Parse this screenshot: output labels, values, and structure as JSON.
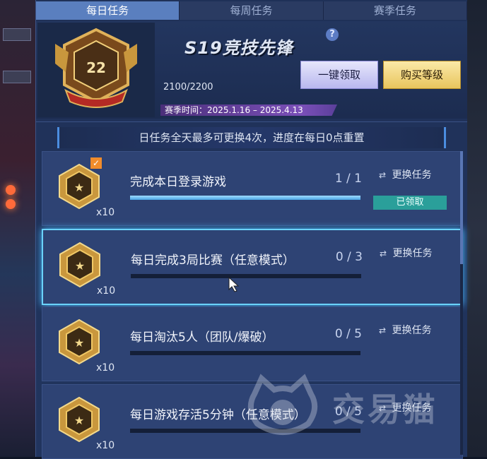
{
  "tabs": [
    {
      "label": "每日任务",
      "active": true
    },
    {
      "label": "每周任务",
      "active": false
    },
    {
      "label": "赛季任务",
      "active": false
    }
  ],
  "header": {
    "rank_level": "22",
    "season_title": "S19竞技先锋",
    "help_icon": "?",
    "progress": "2100/2200",
    "season_time": "赛季时间：2025.1.16 – 2025.4.13",
    "claim_all_label": "一键领取",
    "buy_level_label": "购买等级"
  },
  "info_bar": "日任务全天最多可更换4次，进度在每日0点重置",
  "tasks": [
    {
      "name": "完成本日登录游戏",
      "count": "1 / 1",
      "progress": 1.0,
      "reward": "x10",
      "swap_label": "更换任务",
      "status": "已领取",
      "checked": true
    },
    {
      "name": "每日完成3局比赛（任意模式）",
      "count": "0 / 3",
      "progress": 0.0,
      "reward": "x10",
      "swap_label": "更换任务",
      "status": "",
      "checked": false,
      "selected": true
    },
    {
      "name": "每日淘汰5人（团队/爆破）",
      "count": "0 / 5",
      "progress": 0.0,
      "reward": "x10",
      "swap_label": "更换任务",
      "status": "",
      "checked": false
    },
    {
      "name": "每日游戏存活5分钟（任意模式）",
      "count": "0 / 5",
      "progress": 0.0,
      "reward": "x10",
      "swap_label": "更换任务",
      "status": "",
      "checked": false
    }
  ],
  "watermark": "交易猫",
  "colors": {
    "accent": "#6bd3ff",
    "claimed": "#2a9f9a",
    "buy": "#e8c55d",
    "claim": "#b9b8ef"
  }
}
